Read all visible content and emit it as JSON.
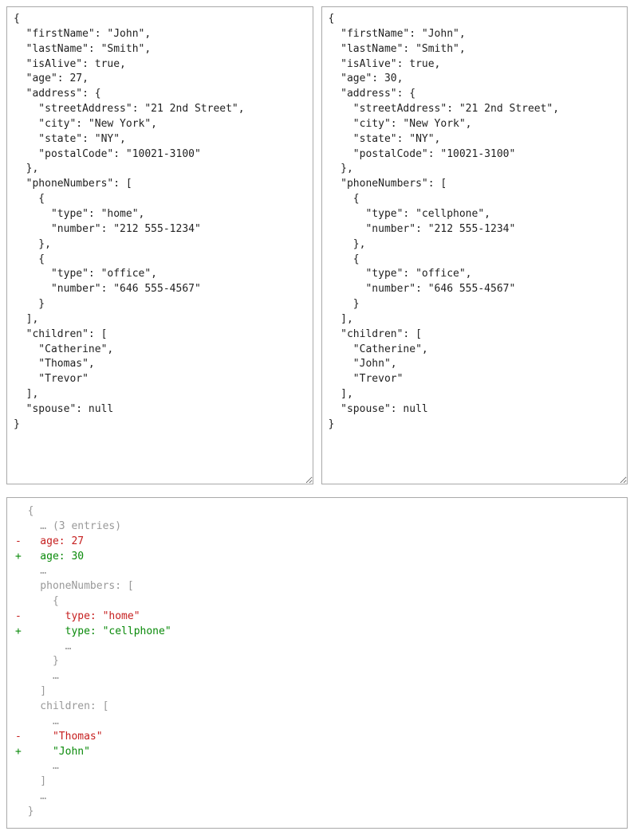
{
  "left_json": "{\n  \"firstName\": \"John\",\n  \"lastName\": \"Smith\",\n  \"isAlive\": true,\n  \"age\": 27,\n  \"address\": {\n    \"streetAddress\": \"21 2nd Street\",\n    \"city\": \"New York\",\n    \"state\": \"NY\",\n    \"postalCode\": \"10021-3100\"\n  },\n  \"phoneNumbers\": [\n    {\n      \"type\": \"home\",\n      \"number\": \"212 555-1234\"\n    },\n    {\n      \"type\": \"office\",\n      \"number\": \"646 555-4567\"\n    }\n  ],\n  \"children\": [\n    \"Catherine\",\n    \"Thomas\",\n    \"Trevor\"\n  ],\n  \"spouse\": null\n}",
  "right_json": "{\n  \"firstName\": \"John\",\n  \"lastName\": \"Smith\",\n  \"isAlive\": true,\n  \"age\": 30,\n  \"address\": {\n    \"streetAddress\": \"21 2nd Street\",\n    \"city\": \"New York\",\n    \"state\": \"NY\",\n    \"postalCode\": \"10021-3100\"\n  },\n  \"phoneNumbers\": [\n    {\n      \"type\": \"cellphone\",\n      \"number\": \"212 555-1234\"\n    },\n    {\n      \"type\": \"office\",\n      \"number\": \"646 555-4567\"\n    }\n  ],\n  \"children\": [\n    \"Catherine\",\n    \"John\",\n    \"Trevor\"\n  ],\n  \"spouse\": null\n}",
  "diff_lines": [
    {
      "kind": "ctx",
      "text": "  {"
    },
    {
      "kind": "ctx",
      "text": "    … (3 entries)"
    },
    {
      "kind": "minus",
      "text": "-   age: 27"
    },
    {
      "kind": "plus",
      "text": "+   age: 30"
    },
    {
      "kind": "ctx",
      "text": "    …"
    },
    {
      "kind": "ctx",
      "text": "    phoneNumbers: ["
    },
    {
      "kind": "ctx",
      "text": "      {"
    },
    {
      "kind": "minus",
      "text": "-       type: \"home\""
    },
    {
      "kind": "plus",
      "text": "+       type: \"cellphone\""
    },
    {
      "kind": "ctx",
      "text": "        …"
    },
    {
      "kind": "ctx",
      "text": "      }"
    },
    {
      "kind": "ctx",
      "text": "      …"
    },
    {
      "kind": "ctx",
      "text": "    ]"
    },
    {
      "kind": "ctx",
      "text": "    children: ["
    },
    {
      "kind": "ctx",
      "text": "      …"
    },
    {
      "kind": "minus",
      "text": "-     \"Thomas\""
    },
    {
      "kind": "plus",
      "text": "+     \"John\""
    },
    {
      "kind": "ctx",
      "text": "      …"
    },
    {
      "kind": "ctx",
      "text": "    ]"
    },
    {
      "kind": "ctx",
      "text": "    …"
    },
    {
      "kind": "ctx",
      "text": "  }"
    }
  ]
}
